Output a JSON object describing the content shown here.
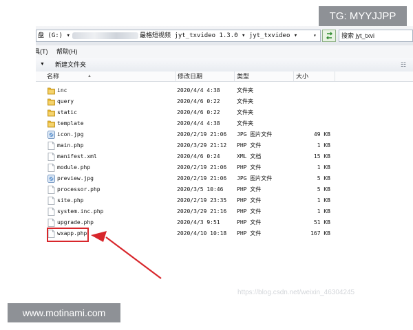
{
  "address": {
    "drive": "盘 (G:) ▾",
    "path": "最格短视频 jyt_txvideo 1.3.0 ▾ jyt_txvideo ▾",
    "dropdown": "▾"
  },
  "search": {
    "label": "搜索 jyt_txvi"
  },
  "menu": {
    "tools": "工具(T)",
    "help": "帮助(H)"
  },
  "toolbar": {
    "new_folder": "新建文件夹",
    "arrow": "▼",
    "view": "☷"
  },
  "columns": {
    "name": "名称",
    "date": "修改日期",
    "type": "类型",
    "size": "大小",
    "sort": "▲"
  },
  "files": [
    {
      "name": "inc",
      "date": "2020/4/4 4:38",
      "type": "文件夹",
      "size": "",
      "icon": "folder-icon"
    },
    {
      "name": "query",
      "date": "2020/4/6 0:22",
      "type": "文件夹",
      "size": "",
      "icon": "folder-icon"
    },
    {
      "name": "static",
      "date": "2020/4/6 0:22",
      "type": "文件夹",
      "size": "",
      "icon": "folder-icon"
    },
    {
      "name": "template",
      "date": "2020/4/4 4:38",
      "type": "文件夹",
      "size": "",
      "icon": "folder-icon"
    },
    {
      "name": "icon.jpg",
      "date": "2020/2/19 21:06",
      "type": "JPG 图片文件",
      "size": "49 KB",
      "icon": "image-file-icon"
    },
    {
      "name": "main.php",
      "date": "2020/3/29 21:12",
      "type": "PHP 文件",
      "size": "1 KB",
      "icon": "file-icon"
    },
    {
      "name": "manifest.xml",
      "date": "2020/4/6 0:24",
      "type": "XML 文档",
      "size": "15 KB",
      "icon": "file-icon"
    },
    {
      "name": "module.php",
      "date": "2020/2/19 21:06",
      "type": "PHP 文件",
      "size": "1 KB",
      "icon": "file-icon"
    },
    {
      "name": "preview.jpg",
      "date": "2020/2/19 21:06",
      "type": "JPG 图片文件",
      "size": "5 KB",
      "icon": "image-file-icon"
    },
    {
      "name": "processor.php",
      "date": "2020/3/5 10:46",
      "type": "PHP 文件",
      "size": "5 KB",
      "icon": "file-icon"
    },
    {
      "name": "site.php",
      "date": "2020/2/19 23:35",
      "type": "PHP 文件",
      "size": "1 KB",
      "icon": "file-icon"
    },
    {
      "name": "system.inc.php",
      "date": "2020/3/29 21:16",
      "type": "PHP 文件",
      "size": "1 KB",
      "icon": "file-icon"
    },
    {
      "name": "upgrade.php",
      "date": "2020/4/3 9:51",
      "type": "PHP 文件",
      "size": "51 KB",
      "icon": "file-icon"
    },
    {
      "name": "wxapp.php",
      "date": "2020/4/10 10:18",
      "type": "PHP 文件",
      "size": "167 KB",
      "icon": "file-icon"
    }
  ],
  "watermarks": {
    "top": "TG: MYYJJPP",
    "bottom": "www.motinami.com",
    "blog": "https://blog.csdn.net/weixin_46304245"
  },
  "colors": {
    "highlight": "#d8262b",
    "folder": "#e8b935",
    "watermark_bg": "#8e9196"
  }
}
